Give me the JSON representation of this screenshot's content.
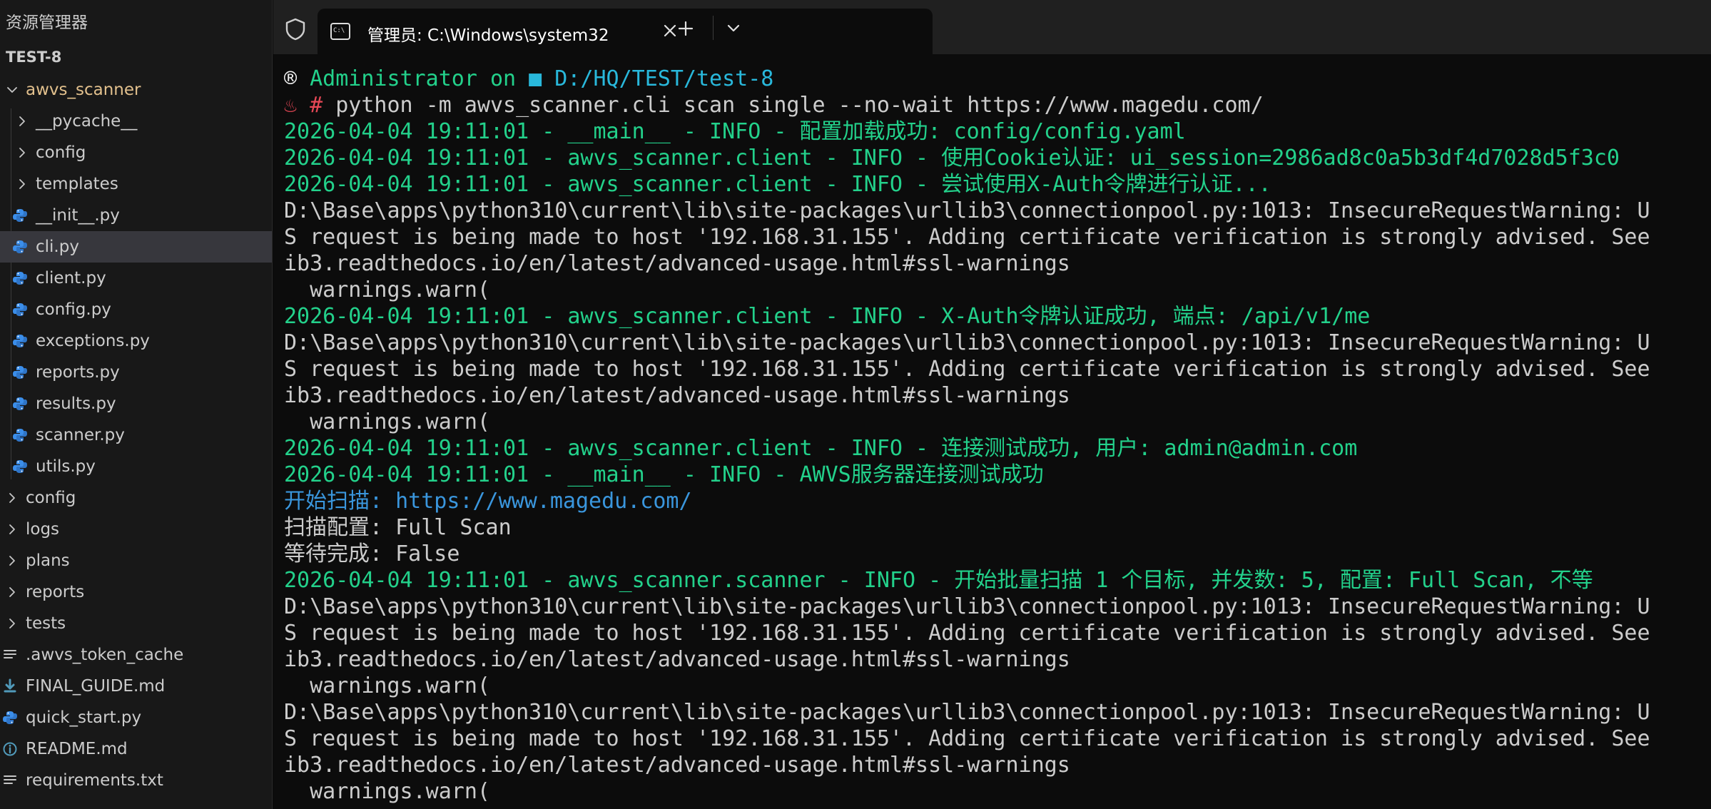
{
  "sidebar": {
    "header": "资源管理器",
    "root": "TEST-8",
    "items": [
      {
        "label": "awvs_scanner",
        "type": "folder-open",
        "level": 0
      },
      {
        "label": "__pycache__",
        "type": "folder",
        "level": 1
      },
      {
        "label": "config",
        "type": "folder",
        "level": 1
      },
      {
        "label": "templates",
        "type": "folder",
        "level": 1
      },
      {
        "label": "__init__.py",
        "type": "python",
        "level": 1
      },
      {
        "label": "cli.py",
        "type": "python",
        "level": 1,
        "selected": true
      },
      {
        "label": "client.py",
        "type": "python",
        "level": 1
      },
      {
        "label": "config.py",
        "type": "python",
        "level": 1
      },
      {
        "label": "exceptions.py",
        "type": "python",
        "level": 1
      },
      {
        "label": "reports.py",
        "type": "python",
        "level": 1
      },
      {
        "label": "results.py",
        "type": "python",
        "level": 1
      },
      {
        "label": "scanner.py",
        "type": "python",
        "level": 1
      },
      {
        "label": "utils.py",
        "type": "python",
        "level": 1
      },
      {
        "label": "config",
        "type": "folder",
        "level": 0
      },
      {
        "label": "logs",
        "type": "folder",
        "level": 0
      },
      {
        "label": "plans",
        "type": "folder",
        "level": 0
      },
      {
        "label": "reports",
        "type": "folder",
        "level": 0
      },
      {
        "label": "tests",
        "type": "folder",
        "level": 0
      },
      {
        "label": ".awvs_token_cache",
        "type": "text",
        "level": 0
      },
      {
        "label": "FINAL_GUIDE.md",
        "type": "markdown",
        "level": 0
      },
      {
        "label": "quick_start.py",
        "type": "python",
        "level": 0
      },
      {
        "label": "README.md",
        "type": "info",
        "level": 0
      },
      {
        "label": "requirements.txt",
        "type": "text",
        "level": 0
      }
    ]
  },
  "terminal": {
    "tab_title": "管理员: C:\\Windows\\system32",
    "tab_icon_text": "C:\\",
    "lines": [
      {
        "segments": [
          {
            "t": "® ",
            "c": "c-bright"
          },
          {
            "t": "Administrator on ",
            "c": "c-info"
          },
          {
            "t": "■ D:/HQ/TEST/test-8",
            "c": "c-blue"
          }
        ]
      },
      {
        "segments": [
          {
            "t": "♨ ",
            "c": "c-red"
          },
          {
            "t": "# ",
            "c": "c-red"
          },
          {
            "t": "python -m awvs_scanner.cli scan single --no-wait https://www.magedu.com/",
            "c": "c-white"
          }
        ]
      },
      {
        "segments": [
          {
            "t": "2026-04-04 19:11:01 - __main__ - INFO - 配置加载成功: config/config.yaml",
            "c": "c-info"
          }
        ]
      },
      {
        "segments": [
          {
            "t": "2026-04-04 19:11:01 - awvs_scanner.client - INFO - 使用Cookie认证: ui_session=2986ad8c0a5b3df4d7028d5f3c0",
            "c": "c-info"
          }
        ]
      },
      {
        "segments": [
          {
            "t": "2026-04-04 19:11:01 - awvs_scanner.client - INFO - 尝试使用X-Auth令牌进行认证...",
            "c": "c-info"
          }
        ]
      },
      {
        "segments": [
          {
            "t": "D:\\Base\\apps\\python310\\current\\lib\\site-packages\\urllib3\\connectionpool.py:1013: InsecureRequestWarning: U",
            "c": "c-white"
          }
        ]
      },
      {
        "segments": [
          {
            "t": "S request is being made to host '192.168.31.155'. Adding certificate verification is strongly advised. See",
            "c": "c-white"
          }
        ]
      },
      {
        "segments": [
          {
            "t": "ib3.readthedocs.io/en/latest/advanced-usage.html#ssl-warnings",
            "c": "c-white"
          }
        ]
      },
      {
        "segments": [
          {
            "t": "  warnings.warn(",
            "c": "c-white"
          }
        ]
      },
      {
        "segments": [
          {
            "t": "2026-04-04 19:11:01 - awvs_scanner.client - INFO - X-Auth令牌认证成功, 端点: /api/v1/me",
            "c": "c-info"
          }
        ]
      },
      {
        "segments": [
          {
            "t": "D:\\Base\\apps\\python310\\current\\lib\\site-packages\\urllib3\\connectionpool.py:1013: InsecureRequestWarning: U",
            "c": "c-white"
          }
        ]
      },
      {
        "segments": [
          {
            "t": "S request is being made to host '192.168.31.155'. Adding certificate verification is strongly advised. See",
            "c": "c-white"
          }
        ]
      },
      {
        "segments": [
          {
            "t": "ib3.readthedocs.io/en/latest/advanced-usage.html#ssl-warnings",
            "c": "c-white"
          }
        ]
      },
      {
        "segments": [
          {
            "t": "  warnings.warn(",
            "c": "c-white"
          }
        ]
      },
      {
        "segments": [
          {
            "t": "2026-04-04 19:11:01 - awvs_scanner.client - INFO - 连接测试成功, 用户: admin@admin.com",
            "c": "c-info"
          }
        ]
      },
      {
        "segments": [
          {
            "t": "2026-04-04 19:11:01 - __main__ - INFO - AWVS服务器连接测试成功",
            "c": "c-info"
          }
        ]
      },
      {
        "segments": [
          {
            "t": "开始扫描: https://www.magedu.com/",
            "c": "c-cyan"
          }
        ]
      },
      {
        "segments": [
          {
            "t": "扫描配置: Full Scan",
            "c": "c-white"
          }
        ]
      },
      {
        "segments": [
          {
            "t": "等待完成: False",
            "c": "c-white"
          }
        ]
      },
      {
        "segments": [
          {
            "t": "2026-04-04 19:11:01 - awvs_scanner.scanner - INFO - 开始批量扫描 1 个目标, 并发数: 5, 配置: Full Scan, 不等",
            "c": "c-info"
          }
        ]
      },
      {
        "segments": [
          {
            "t": "D:\\Base\\apps\\python310\\current\\lib\\site-packages\\urllib3\\connectionpool.py:1013: InsecureRequestWarning: U",
            "c": "c-white"
          }
        ]
      },
      {
        "segments": [
          {
            "t": "S request is being made to host '192.168.31.155'. Adding certificate verification is strongly advised. See",
            "c": "c-white"
          }
        ]
      },
      {
        "segments": [
          {
            "t": "ib3.readthedocs.io/en/latest/advanced-usage.html#ssl-warnings",
            "c": "c-white"
          }
        ]
      },
      {
        "segments": [
          {
            "t": "  warnings.warn(",
            "c": "c-white"
          }
        ]
      },
      {
        "segments": [
          {
            "t": "D:\\Base\\apps\\python310\\current\\lib\\site-packages\\urllib3\\connectionpool.py:1013: InsecureRequestWarning: U",
            "c": "c-white"
          }
        ]
      },
      {
        "segments": [
          {
            "t": "S request is being made to host '192.168.31.155'. Adding certificate verification is strongly advised. See",
            "c": "c-white"
          }
        ]
      },
      {
        "segments": [
          {
            "t": "ib3.readthedocs.io/en/latest/advanced-usage.html#ssl-warnings",
            "c": "c-white"
          }
        ]
      },
      {
        "segments": [
          {
            "t": "  warnings.warn(",
            "c": "c-white"
          }
        ]
      }
    ]
  },
  "colors": {
    "sidebar_bg": "#181818",
    "selected_bg": "#37373d",
    "open_folder": "#e2c08d",
    "terminal_bg": "#0c0c0c",
    "tabbar_bg": "#202020",
    "info_green": "#23d18b",
    "cyan": "#3a96dd",
    "python_icon": "#3b8eea"
  },
  "icons": {
    "shield": "shield-icon",
    "terminal": "terminal-icon",
    "close": "close-icon",
    "add": "plus-icon",
    "dropdown": "chevron-down-icon"
  }
}
